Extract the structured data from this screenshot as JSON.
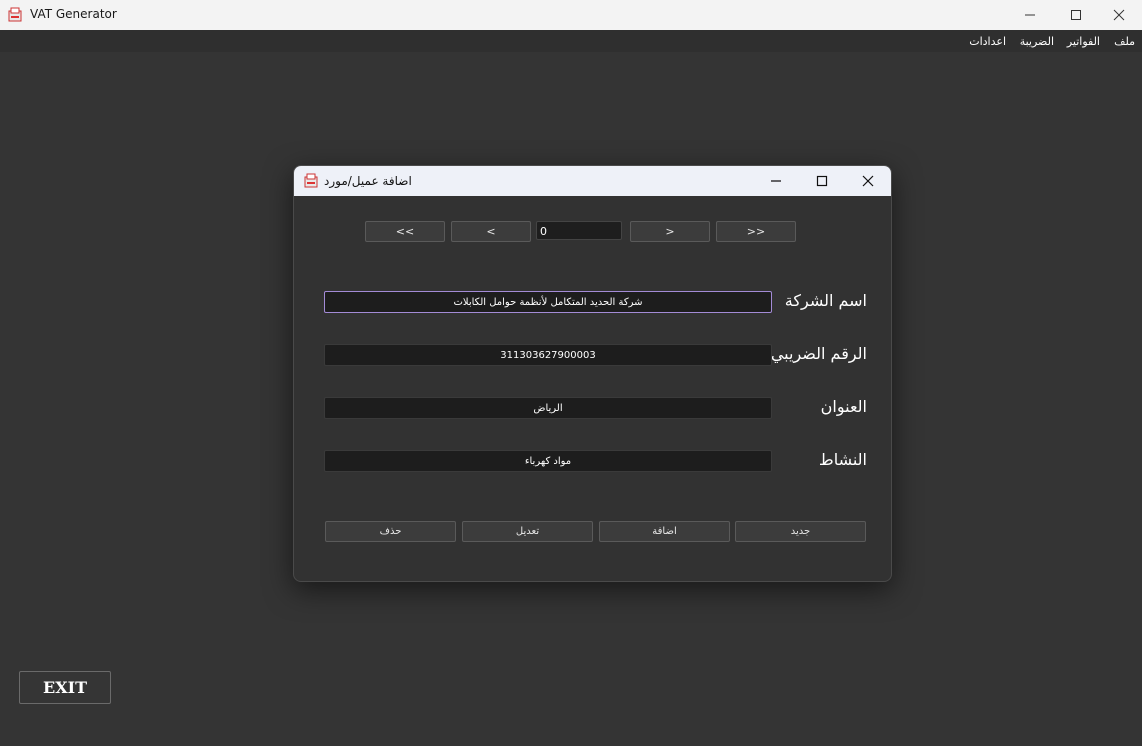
{
  "app": {
    "title": "VAT Generator",
    "icon": "receipt-icon"
  },
  "menu": {
    "items": [
      {
        "label": "ملف"
      },
      {
        "label": "الفواتير"
      },
      {
        "label": "الضريبة"
      },
      {
        "label": "اعدادات"
      }
    ]
  },
  "dialog": {
    "title": "اضافة عميل/مورد",
    "nav": {
      "first_label": "<<",
      "prev_label": "<",
      "record_value": "0",
      "next_label": ">",
      "last_label": ">>"
    },
    "fields": {
      "company_name": {
        "label": "اسم الشركة",
        "value": "شركة الحديد المتكامل لأنظمة حوامل الكابلات"
      },
      "tax_number": {
        "label": "الرقم الضريبي",
        "value": "311303627900003"
      },
      "address": {
        "label": "العنوان",
        "value": "الرياض"
      },
      "activity": {
        "label": "النشاط",
        "value": "مواد كهرباء"
      }
    },
    "actions": {
      "new_label": "جديد",
      "add_label": "اضافة",
      "edit_label": "تعديل",
      "delete_label": "حذف"
    }
  },
  "exit": {
    "label": "EXIT"
  },
  "colors": {
    "background": "#343434",
    "focus_border": "#a38bd6",
    "titlebar": "#f3f3f3"
  }
}
